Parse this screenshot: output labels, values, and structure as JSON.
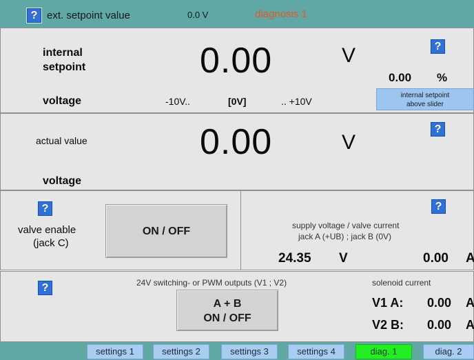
{
  "topbar": {
    "help": "?",
    "ext_label": "ext. setpoint value",
    "ext_value": "0.0 V",
    "diag_label": "diagnosis 1"
  },
  "setpoint": {
    "label_line1": "internal",
    "label_line2": "setpoint",
    "value": "0.00",
    "unit": "V",
    "help": "?",
    "percent_value": "0.00",
    "percent_unit": "%",
    "voltage_label": "voltage",
    "range_min": "-10V..",
    "range_mid": "[0V]",
    "range_max": ".. +10V",
    "slider_button_line1": "internal setpoint",
    "slider_button_line2": "above slider"
  },
  "actual": {
    "label": "actual value",
    "value": "0.00",
    "unit": "V",
    "help": "?",
    "voltage_label": "voltage"
  },
  "valve": {
    "help": "?",
    "label_line1": "valve enable",
    "label_line2": "(jack C)",
    "button_label": "ON / OFF"
  },
  "supply": {
    "help": "?",
    "title_line1": "supply voltage / valve current",
    "title_line2": "jack A (+UB) ; jack B (0V)",
    "voltage_value": "24.35",
    "voltage_unit": "V",
    "current_value": "0.00",
    "current_unit": "A"
  },
  "outputs": {
    "help": "?",
    "title": "24V switching- or PWM outputs (V1 ; V2)",
    "button_line1": "A + B",
    "button_line2": "ON / OFF",
    "solenoid_label": "solenoid current",
    "v1_label": "V1 A:",
    "v1_value": "0.00",
    "v1_unit": "A",
    "v2_label": "V2 B:",
    "v2_value": "0.00",
    "v2_unit": "A"
  },
  "tabs": [
    {
      "label": "settings 1"
    },
    {
      "label": "settings 2"
    },
    {
      "label": "settings 3"
    },
    {
      "label": "settings 4"
    },
    {
      "label": "diag. 1"
    },
    {
      "label": "diag. 2"
    }
  ],
  "colors": {
    "bar": "#5fa8a3",
    "panel": "#e6e6e6",
    "help_button": "#2f6fd6",
    "tab": "#a8cdf1",
    "active_tab": "#22ee22",
    "diag_text": "#e8552a"
  }
}
